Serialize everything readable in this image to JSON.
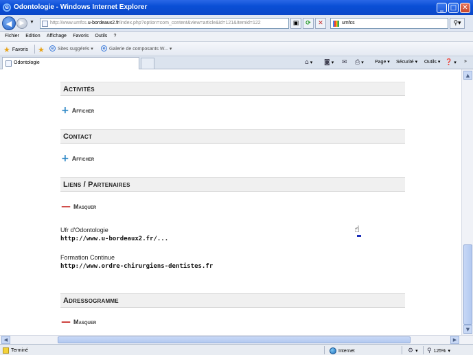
{
  "window": {
    "title": "Odontologie - Windows Internet Explorer",
    "controls": [
      "_",
      "□",
      "✕"
    ]
  },
  "address": {
    "url_prefix": "http://www.umfcs.",
    "url_host": "u-bordeaux2.fr",
    "url_suffix": "/index.php?option=com_content&view=article&id=121&Itemid=122",
    "search_value": "umfcs"
  },
  "menu": [
    "Fichier",
    "Edition",
    "Affichage",
    "Favoris",
    "Outils",
    "?"
  ],
  "favorites_bar": {
    "favorites_label": "Favoris",
    "suggested_label": "Sites suggérés ▾",
    "gallery_label": "Galerie de composants W... ▾"
  },
  "tab": {
    "label": "Odontologie"
  },
  "commandbar": {
    "page_label": "Page ▾",
    "security_label": "Sécurité ▾",
    "tools_label": "Outils ▾"
  },
  "sections": {
    "activities": {
      "heading": "Activités",
      "toggle": "Afficher"
    },
    "contact": {
      "heading": "Contact",
      "toggle": "Afficher"
    },
    "links": {
      "heading": "Liens / Partenaires",
      "toggle": "Masquer",
      "items": [
        {
          "label": "Ufr d'Odontologie",
          "url": "http://www.u-bordeaux2.fr/..."
        },
        {
          "label": "Formation Continue",
          "url": "http://www.ordre-chirurgiens-dentistes.fr"
        }
      ]
    },
    "address_book": {
      "heading": "Adressogramme",
      "toggle": "Masquer"
    }
  },
  "status": {
    "text": "Terminé",
    "zone": "Internet",
    "zoom": "125%"
  }
}
